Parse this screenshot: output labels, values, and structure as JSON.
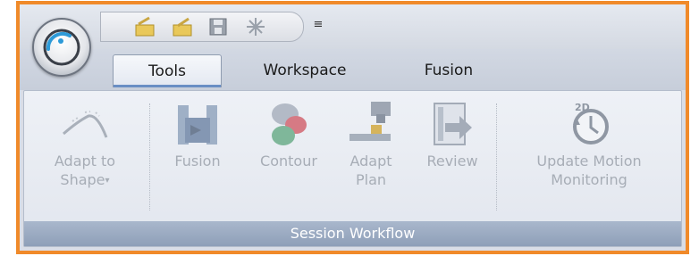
{
  "qat": {
    "icons": [
      "import-icon",
      "export-icon",
      "save-icon",
      "snowflake-icon"
    ],
    "dropdown_glyph": "≡"
  },
  "tabs": [
    {
      "label": "Tools",
      "active": true
    },
    {
      "label": "Workspace",
      "active": false
    },
    {
      "label": "Fusion",
      "active": false
    }
  ],
  "ribbon": {
    "group_label": "Session Workflow",
    "buttons": {
      "adapt_to_shape": {
        "line1": "Adapt to",
        "line2": "Shape",
        "caret": "▾",
        "icon": "curve-icon"
      },
      "fusion": {
        "line1": "Fusion",
        "icon": "fusion-icon"
      },
      "contour": {
        "line1": "Contour",
        "icon": "contour-blobs-icon"
      },
      "adapt_plan": {
        "line1": "Adapt",
        "line2": "Plan",
        "icon": "adapt-plan-icon"
      },
      "review": {
        "line1": "Review",
        "icon": "review-arrow-icon"
      },
      "update_motion": {
        "line1": "Update Motion",
        "line2": "Monitoring",
        "icon": "motion-monitor-2d-icon",
        "icon_text": "2D"
      }
    }
  },
  "colors": {
    "frame_border": "#f08a2a",
    "disabled_text": "#a7adb6",
    "group_bar": "#8e9fb8"
  }
}
